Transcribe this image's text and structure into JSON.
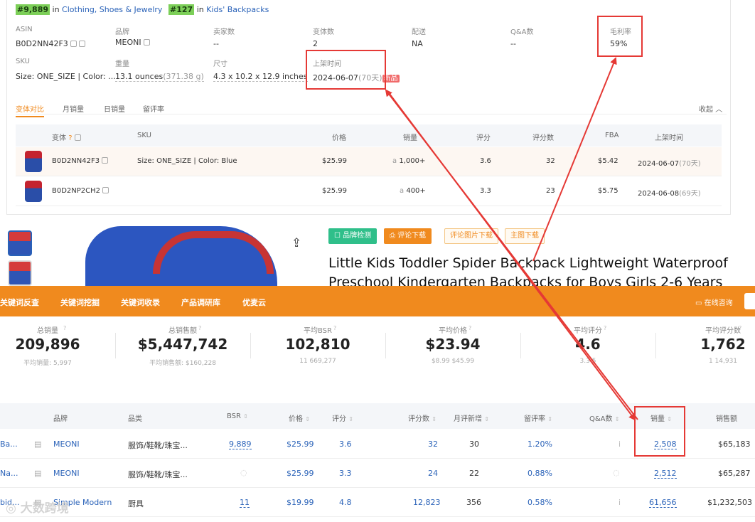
{
  "rank": {
    "primary_rank": "#9,889",
    "primary_in": "in",
    "primary_category": "Clothing, Shoes & Jewelry",
    "secondary_rank": "#127",
    "secondary_in": "in",
    "secondary_category": "Kids' Backpacks"
  },
  "details": {
    "asin_label": "ASIN",
    "asin": "B0D2NN42F3",
    "brand_label": "品牌",
    "brand": "MEONI",
    "sellers_label": "卖家数",
    "sellers": "--",
    "variants_label": "变体数",
    "variants": "2",
    "shipping_label": "配送",
    "shipping": "NA",
    "qa_label": "Q&A数",
    "qa": "--",
    "margin_label": "毛利率",
    "margin": "59%",
    "sku_label": "SKU",
    "sku": "Size: ONE_SIZE | Color: ...",
    "weight_label": "重量",
    "weight": "13.1 ounces",
    "weight_g": "(371.38 g)",
    "size_label": "尺寸",
    "size": "4.3 x 10.2 x 12.9 inches",
    "listed_label": "上架时间",
    "listed": "2024-06-07",
    "listed_days": "(70天)",
    "new_badge": "新品"
  },
  "tabs": {
    "t1": "变体对比",
    "t2": "月销量",
    "t3": "日销量",
    "t4": "留评率",
    "collapse": "收起"
  },
  "variant_table": {
    "headers": {
      "variant": "变体",
      "sku": "SKU",
      "price": "价格",
      "sales": "销量",
      "rating": "评分",
      "reviews": "评分数",
      "fba": "FBA",
      "listed": "上架时间"
    },
    "rows": [
      {
        "asin": "B0D2NN42F3",
        "sku": "Size: ONE_SIZE | Color: Blue",
        "price": "$25.99",
        "sales": "1,000+",
        "rating": "3.6",
        "reviews": "32",
        "fba": "$5.42",
        "date": "2024-06-07",
        "days": "(70天)"
      },
      {
        "asin": "B0D2NP2CH2",
        "sku": "",
        "price": "$25.99",
        "sales": "400+",
        "rating": "3.3",
        "reviews": "23",
        "fba": "$5.75",
        "date": "2024-06-08",
        "days": "(69天)"
      }
    ]
  },
  "product": {
    "buttons": {
      "brand_check": "品牌检测",
      "review_download": "评论下载",
      "review_img_download": "评论图片下载",
      "main_img_download": "主图下载"
    },
    "title": "Little Kids Toddler Spider Backpack Lightweight Waterproof Preschool Kindergarten Backpacks for Boys Girls 2-6 Years"
  },
  "nav": {
    "n1": "关键词反查",
    "n2": "关键词挖掘",
    "n3": "关键词收录",
    "n4": "产品调研库",
    "n5": "优麦云",
    "consult": "在线咨询"
  },
  "stats": [
    {
      "label": "总销量",
      "value": "209,896",
      "sub": "平均销量: 5,997"
    },
    {
      "label": "总销售额",
      "value": "$5,447,742",
      "sub": "平均销售额: $160,228"
    },
    {
      "label": "平均BSR",
      "value": "102,810",
      "sub": "11   669,277"
    },
    {
      "label": "平均价格",
      "value": "$23.94",
      "sub": "$8.99   $45.99"
    },
    {
      "label": "平均评分",
      "value": "4.6",
      "sub": "3.3   5"
    },
    {
      "label": "平均评分数",
      "value": "1,762",
      "sub": "1   14,931"
    }
  ],
  "bottom_table": {
    "headers": {
      "brand": "品牌",
      "category": "品类",
      "bsr": "BSR",
      "price": "价格",
      "rating": "评分",
      "reviews": "评分数",
      "monthly_new": "月评新增",
      "review_rate": "留评率",
      "qa": "Q&A数",
      "sales": "销量",
      "revenue": "销售额"
    },
    "rows": [
      {
        "name": "Ba...",
        "brand": "MEONI",
        "category": "服饰/鞋靴/珠宝...",
        "bsr": "9,889",
        "price": "$25.99",
        "rating": "3.6",
        "reviews": "32",
        "monthly_new": "30",
        "review_rate": "1.20%",
        "qa": "i",
        "sales": "2,508",
        "revenue": "$65,183"
      },
      {
        "name": "Na...",
        "brand": "MEONI",
        "category": "服饰/鞋靴/珠宝...",
        "bsr": "",
        "price": "$25.99",
        "rating": "3.3",
        "reviews": "24",
        "monthly_new": "22",
        "review_rate": "0.88%",
        "qa": "",
        "sales": "2,512",
        "revenue": "$65,287"
      },
      {
        "name": "bid...",
        "brand": "Simple Modern",
        "category": "厨具",
        "bsr": "11",
        "price": "$19.99",
        "rating": "4.8",
        "reviews": "12,823",
        "monthly_new": "356",
        "review_rate": "0.58%",
        "qa": "i",
        "sales": "61,656",
        "revenue": "$1,232,503"
      }
    ]
  },
  "watermark": "大数跨境",
  "colors": {
    "orange": "#f08a1e",
    "highlight_red": "#e53935",
    "link_blue": "#2a62b8",
    "rank_green": "#7ccf58"
  }
}
